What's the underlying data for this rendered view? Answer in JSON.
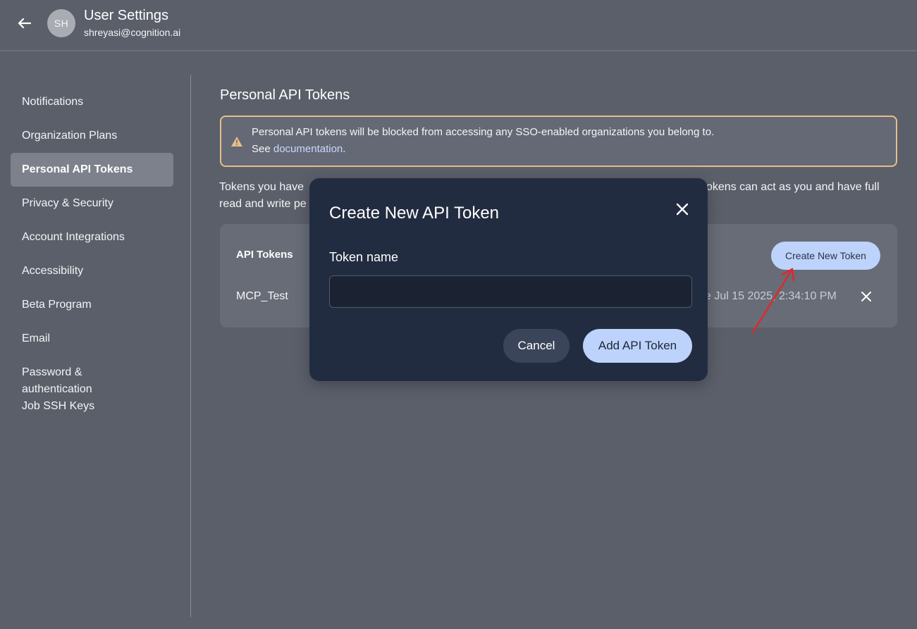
{
  "header": {
    "title": "User Settings",
    "email": "shreyasi@cognition.ai",
    "avatar_initials": "SH",
    "back_icon": "arrow-left-icon"
  },
  "sidebar": {
    "items": [
      {
        "label": "Notifications"
      },
      {
        "label": "Organization Plans"
      },
      {
        "label": "Personal API Tokens",
        "active": true
      },
      {
        "label": "Privacy & Security"
      },
      {
        "label": "Account Integrations"
      },
      {
        "label": "Accessibility"
      },
      {
        "label": "Beta Program"
      },
      {
        "label": "Email"
      },
      {
        "label": "Password & authentication"
      },
      {
        "label": "Job SSH Keys"
      }
    ]
  },
  "main": {
    "title": "Personal API Tokens",
    "warning": {
      "icon": "warning-triangle-icon",
      "line1": "Personal API tokens will be blocked from accessing any SSO-enabled organizations you belong to.",
      "line2_prefix": "See ",
      "link": "documentation",
      "line2_suffix": "."
    },
    "description_left": "Tokens you have",
    "description_left2": "read and write pe",
    "description_right": "okens can act as you and have full",
    "tokens": {
      "heading": "API Tokens",
      "create_button": "Create New Token",
      "rows": [
        {
          "name": "MCP_Test",
          "date": "e Jul 15 2025, 2:34:10 PM"
        }
      ]
    }
  },
  "modal": {
    "title": "Create New API Token",
    "field_label": "Token name",
    "input_value": "",
    "input_placeholder": "",
    "cancel_label": "Cancel",
    "submit_label": "Add API Token"
  },
  "colors": {
    "background": "#5b5f6a",
    "accent_button": "#bdd3fb",
    "modal_bg": "#222c40",
    "warning_border": "#e6bf86",
    "annotation_arrow": "#e0282b"
  }
}
